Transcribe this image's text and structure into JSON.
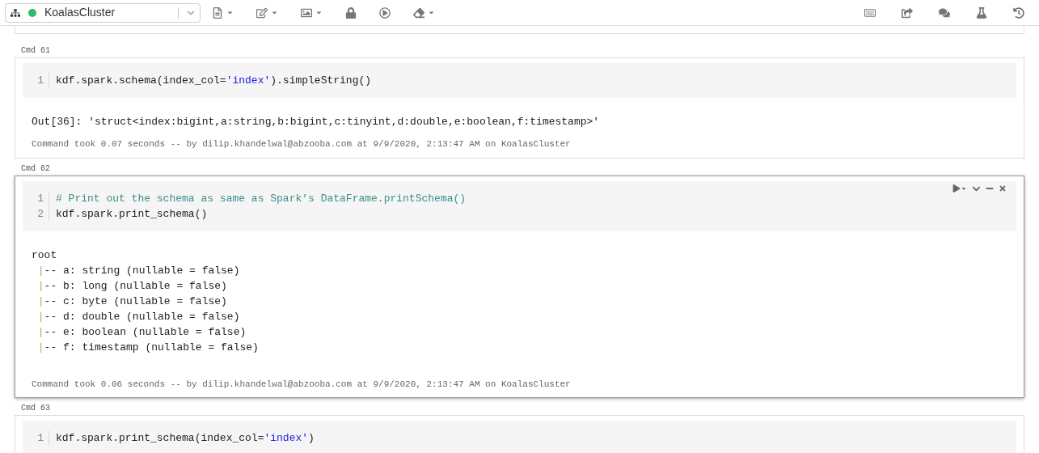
{
  "toolbar": {
    "cluster": {
      "name": "KoalasCluster",
      "running": true
    }
  },
  "cells": [
    {
      "label": "Cmd 61",
      "focused": false,
      "code": [
        {
          "number": "1",
          "segments": [
            {
              "text": "kdf.spark.schema(index_col=",
              "kind": "plain"
            },
            {
              "text": "'index'",
              "kind": "string"
            },
            {
              "text": ").simpleString()",
              "kind": "plain"
            }
          ]
        }
      ],
      "output": [
        [
          {
            "text": "Out[36]: 'struct<index:bigint,a:string,b:bigint,c:tinyint,d:double,e:boolean,f:timestamp>'",
            "kind": "plain"
          }
        ]
      ],
      "footer": "Command took 0.07 seconds -- by dilip.khandelwal@abzooba.com at 9/9/2020, 2:13:47 AM on KoalasCluster"
    },
    {
      "label": "Cmd 62",
      "focused": true,
      "code": [
        {
          "number": "1",
          "segments": [
            {
              "text": "# Print out the schema as same as Spark’s DataFrame.printSchema()",
              "kind": "comment"
            }
          ]
        },
        {
          "number": "2",
          "segments": [
            {
              "text": "kdf.spark.print_schema()",
              "kind": "plain"
            }
          ]
        }
      ],
      "output": [
        [
          {
            "text": "root",
            "kind": "plain"
          }
        ],
        [
          {
            "text": " |",
            "kind": "pipe"
          },
          {
            "text": "-- a: string (nullable = false)",
            "kind": "plain"
          }
        ],
        [
          {
            "text": " |",
            "kind": "pipe"
          },
          {
            "text": "-- b: long (nullable = false)",
            "kind": "plain"
          }
        ],
        [
          {
            "text": " |",
            "kind": "pipe"
          },
          {
            "text": "-- c: byte (nullable = false)",
            "kind": "plain"
          }
        ],
        [
          {
            "text": " |",
            "kind": "pipe"
          },
          {
            "text": "-- d: double (nullable = false)",
            "kind": "plain"
          }
        ],
        [
          {
            "text": " |",
            "kind": "pipe"
          },
          {
            "text": "-- e: boolean (nullable = false)",
            "kind": "plain"
          }
        ],
        [
          {
            "text": " |",
            "kind": "pipe"
          },
          {
            "text": "-- f: timestamp (nullable = false)",
            "kind": "plain"
          }
        ]
      ],
      "footer": "Command took 0.06 seconds -- by dilip.khandelwal@abzooba.com at 9/9/2020, 2:13:47 AM on KoalasCluster"
    },
    {
      "label": "Cmd 63",
      "focused": false,
      "code": [
        {
          "number": "1",
          "segments": [
            {
              "text": "kdf.spark.print_schema(index_col=",
              "kind": "plain"
            },
            {
              "text": "'index'",
              "kind": "string"
            },
            {
              "text": ")",
              "kind": "plain"
            }
          ]
        }
      ]
    }
  ]
}
